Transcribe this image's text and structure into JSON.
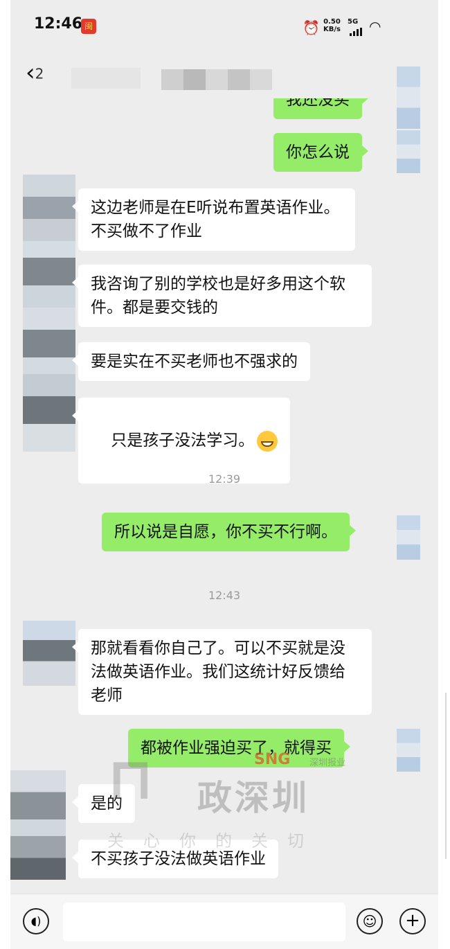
{
  "status_bar": {
    "time": "12:46",
    "badge": "闽",
    "alarm_icon": "alarm-icon",
    "speed_value": "0.50",
    "speed_unit": "KB/s",
    "network": "5G",
    "wifi_icon": "wifi-icon"
  },
  "header": {
    "back_icon": "chevron-left-icon",
    "title_partial": "2"
  },
  "messages": [
    {
      "side": "right",
      "text": "我还没买"
    },
    {
      "side": "right",
      "text": "你怎么说"
    },
    {
      "side": "left",
      "text": "这边老师是在E听说布置英语作业。不买做不了作业"
    },
    {
      "side": "left",
      "text": "我咨询了别的学校也是好多用这个软件。都是要交钱的"
    },
    {
      "side": "left",
      "text": "要是实在不买老师也不强求的"
    },
    {
      "side": "left",
      "text": "只是孩子没法学习。",
      "emoji": "grinning-face-icon"
    },
    {
      "side": "right",
      "text": "所以说是自愿，你不买不行啊。"
    },
    {
      "side": "left",
      "text": "那就看看你自己了。可以不买就是没法做英语作业。我们这统计好反馈给老师"
    },
    {
      "side": "right",
      "text": "都被作业强迫买了，就得买"
    },
    {
      "side": "left",
      "text": "是的"
    },
    {
      "side": "left",
      "text": "不买孩子没法做英语作业"
    }
  ],
  "timestamps": [
    "12:39",
    "12:43"
  ],
  "watermark": {
    "main": "政深圳",
    "sub": "关心你的关切",
    "brand": "SNG",
    "brand_sub": "深圳报业"
  },
  "input_bar": {
    "voice_icon": "voice-icon",
    "emoji_icon": "smiley-icon",
    "plus_icon": "plus-icon"
  },
  "colors": {
    "chat_bg": "#ededed",
    "left_bubble": "#ffffff",
    "right_bubble": "#95ec69"
  }
}
